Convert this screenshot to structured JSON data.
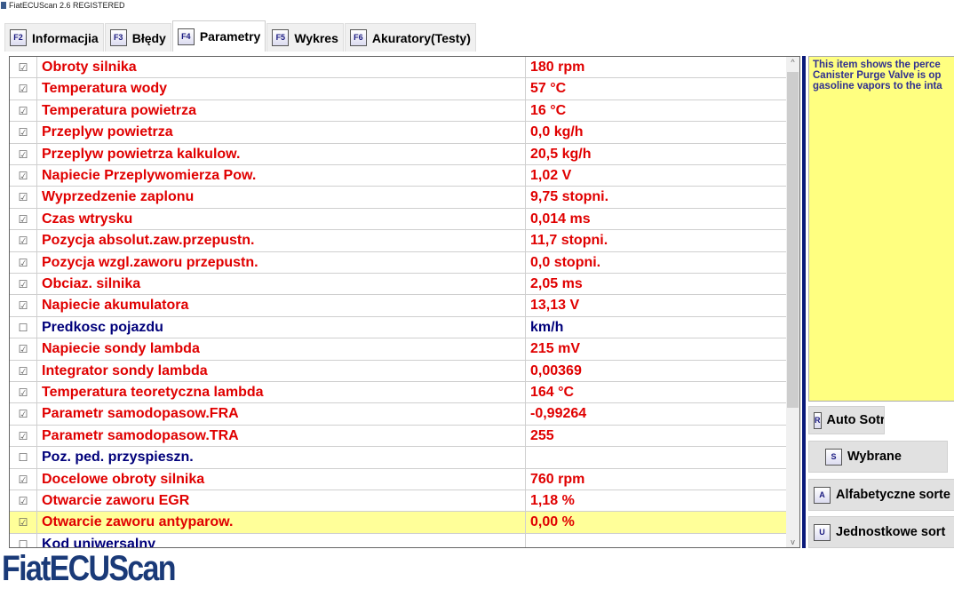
{
  "window": {
    "title": "FiatECUScan 2.6 REGISTERED"
  },
  "tabs": [
    {
      "key": "F2",
      "label": "Informacjia"
    },
    {
      "key": "F3",
      "label": "Błędy"
    },
    {
      "key": "F4",
      "label": "Parametry",
      "active": true
    },
    {
      "key": "F5",
      "label": "Wykres"
    },
    {
      "key": "F6",
      "label": "Akuratory(Testy)"
    }
  ],
  "params": [
    {
      "checked": true,
      "name": "Obroty silnika",
      "value": "180 rpm",
      "color": "red"
    },
    {
      "checked": true,
      "name": "Temperatura wody",
      "value": "57 °C",
      "color": "red"
    },
    {
      "checked": true,
      "name": "Temperatura powietrza",
      "value": "16 °C",
      "color": "red"
    },
    {
      "checked": true,
      "name": "Przeplyw powietrza",
      "value": "0,0 kg/h",
      "color": "red"
    },
    {
      "checked": true,
      "name": "Przeplyw powietrza kalkulow.",
      "value": "20,5 kg/h",
      "color": "red"
    },
    {
      "checked": true,
      "name": "Napiecie Przeplywomierza Pow.",
      "value": "1,02 V",
      "color": "red"
    },
    {
      "checked": true,
      "name": "Wyprzedzenie zaplonu",
      "value": "9,75  stopni.",
      "color": "red"
    },
    {
      "checked": true,
      "name": "Czas wtrysku",
      "value": "0,014 ms",
      "color": "red"
    },
    {
      "checked": true,
      "name": "Pozycja absolut.zaw.przepustn.",
      "value": "11,7  stopni.",
      "color": "red"
    },
    {
      "checked": true,
      "name": "Pozycja wzgl.zaworu przepustn.",
      "value": "0,0  stopni.",
      "color": "red"
    },
    {
      "checked": true,
      "name": "Obciaz. silnika",
      "value": "2,05 ms",
      "color": "red"
    },
    {
      "checked": true,
      "name": "Napiecie akumulatora",
      "value": "13,13 V",
      "color": "red"
    },
    {
      "checked": false,
      "name": "Predkosc pojazdu",
      "value": " km/h",
      "color": "blue"
    },
    {
      "checked": true,
      "name": "Napiecie sondy lambda",
      "value": "215 mV",
      "color": "red"
    },
    {
      "checked": true,
      "name": "Integrator sondy lambda",
      "value": "0,00369",
      "color": "red"
    },
    {
      "checked": true,
      "name": "Temperatura teoretyczna lambda",
      "value": "164 °C",
      "color": "red"
    },
    {
      "checked": true,
      "name": "Parametr samodopasow.FRA",
      "value": "-0,99264",
      "color": "red"
    },
    {
      "checked": true,
      "name": "Parametr samodopasow.TRA",
      "value": "255",
      "color": "red"
    },
    {
      "checked": false,
      "name": "Poz. ped. przyspieszn.",
      "value": "",
      "color": "blue"
    },
    {
      "checked": true,
      "name": "Docelowe obroty silnika",
      "value": "760 rpm",
      "color": "red"
    },
    {
      "checked": true,
      "name": "Otwarcie zaworu EGR",
      "value": "1,18 %",
      "color": "red"
    },
    {
      "checked": true,
      "name": "Otwarcie zaworu antyparow.",
      "value": "0,00 %",
      "color": "red",
      "selected": true
    },
    {
      "checked": false,
      "name": "Kod uniwersalny",
      "value": "",
      "color": "blue"
    }
  ],
  "info": {
    "lines": [
      "This item shows the perce",
      "Canister Purge Valve is op",
      "gasoline vapors to the inta"
    ]
  },
  "buttons": [
    {
      "key": "R",
      "label": "Auto Sotr."
    },
    {
      "key": "S",
      "label": "Wybrane"
    },
    {
      "key": "A",
      "label": "Alfabetyczne sorte"
    },
    {
      "key": "U",
      "label": "Jednostkowe sort"
    }
  ],
  "logo": "FiatECUScan"
}
